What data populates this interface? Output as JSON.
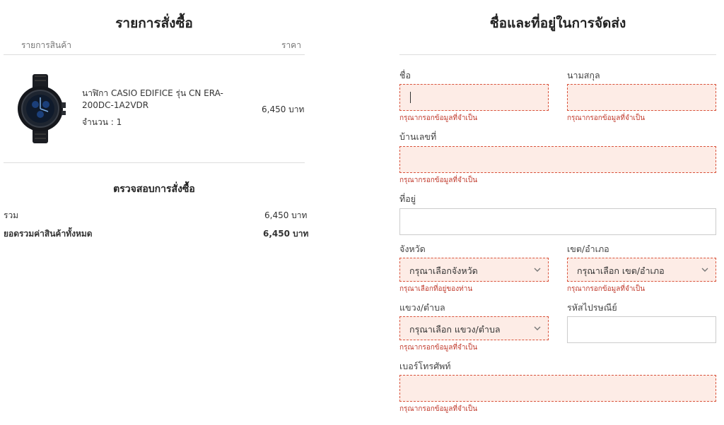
{
  "order": {
    "title": "รายการสั่งซื้อ",
    "col_product": "รายการสินค้า",
    "col_price": "ราคา",
    "item": {
      "name_line1": "นาฬิกา CASIO EDIFICE รุ่น CN ERA-",
      "name_line2": "200DC-1A2VDR",
      "qty": "จำนวน : 1",
      "price": "6,450 บาท"
    },
    "summary_title": "ตรวจสอบการสั่งซื้อ",
    "subtotal_label": "รวม",
    "subtotal_value": "6,450 บาท",
    "total_label": "ยอดรวมค่าสินค้าทั้งหมด",
    "total_value": "6,450 บาท"
  },
  "shipping": {
    "title": "ชื่อและที่อยู่ในการจัดส่ง",
    "first_name_label": "ชื่อ",
    "last_name_label": "นามสกุล",
    "house_no_label": "บ้านเลขที่",
    "address_label": "ที่อยู่",
    "province_label": "จังหวัด",
    "district_label": "เขต/อำเภอ",
    "subdistrict_label": "แขวง/ตำบล",
    "postcode_label": "รหัสไปรษณีย์",
    "phone_label": "เบอร์โทรศัพท์",
    "province_value": "กรุณาเลือกจังหวัด",
    "district_value": "กรุณาเลือก เขต/อำเภอ",
    "subdistrict_value": "กรุณาเลือก แขวง/ตำบล",
    "error_required": "กรุณากรอกข้อมูลที่จำเป็น",
    "error_province": "กรุณาเลือกที่อยู่ของท่าน"
  }
}
